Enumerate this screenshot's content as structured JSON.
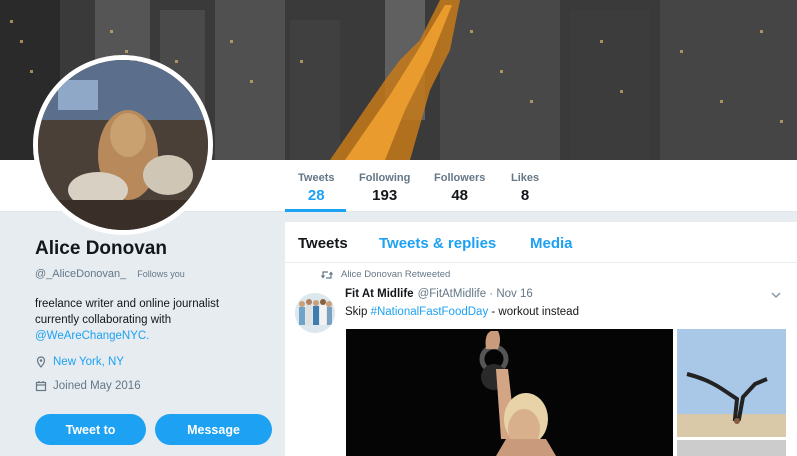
{
  "profile": {
    "name": "Alice Donovan",
    "handle": "@_AliceDonovan_",
    "follows_you": "Follows you",
    "bio_lines": [
      "freelance writer and online journalist",
      "currently collaborating with"
    ],
    "bio_mention": "@WeAreChangeNYC.",
    "location": "New York, NY",
    "joined": "Joined May 2016",
    "tweet_to_label": "Tweet to",
    "message_label": "Message"
  },
  "stats": {
    "tweets": {
      "label": "Tweets",
      "value": "28"
    },
    "following": {
      "label": "Following",
      "value": "193"
    },
    "followers": {
      "label": "Followers",
      "value": "48"
    },
    "likes": {
      "label": "Likes",
      "value": "8"
    }
  },
  "tabs": {
    "tweets": "Tweets",
    "replies": "Tweets & replies",
    "media": "Media"
  },
  "tweet": {
    "retweeted_by": "Alice Donovan Retweeted",
    "author": "Fit At Midlife",
    "handle_date": "@FitAtMidlife · Nov 16",
    "text_prefix": "Skip ",
    "hashtag": "#NationalFastFoodDay",
    "text_suffix": " - workout instead"
  },
  "colors": {
    "accent": "#1da1f2",
    "text": "#14171a",
    "muted": "#657786",
    "background": "#e6ecf0"
  },
  "icons": [
    "location-pin-icon",
    "calendar-icon",
    "retweet-icon",
    "chevron-down-icon"
  ]
}
